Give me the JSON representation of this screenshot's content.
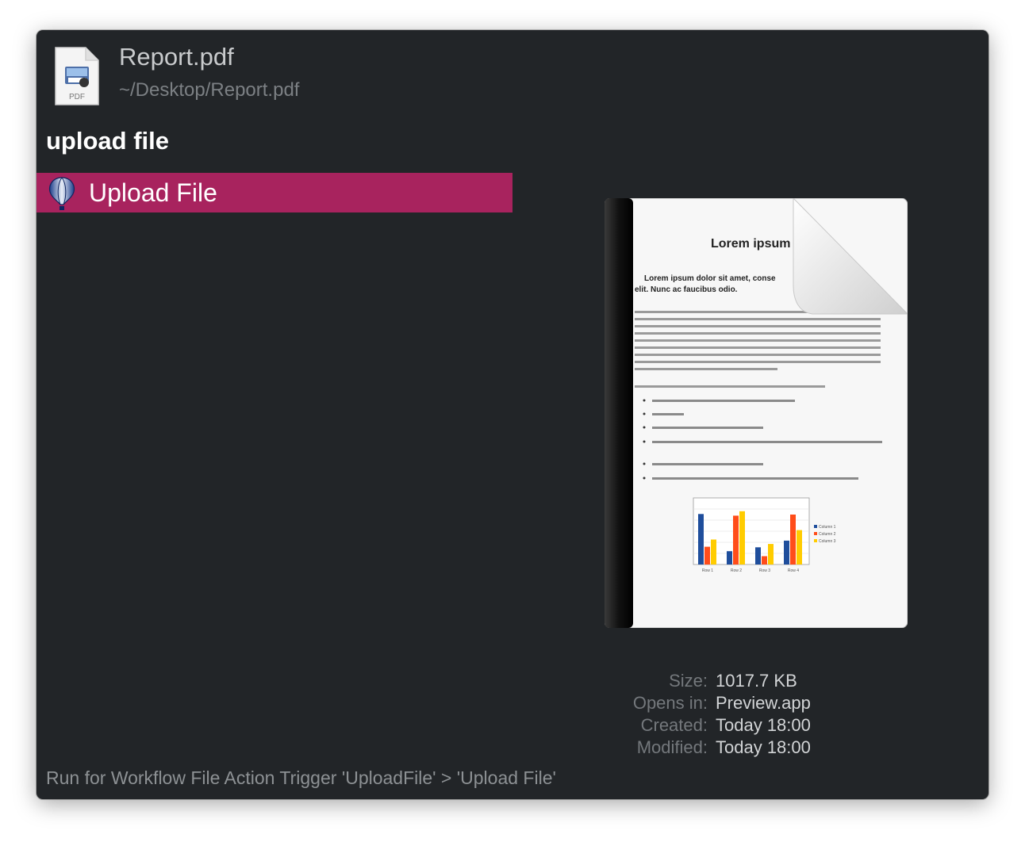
{
  "file": {
    "name": "Report.pdf",
    "path": "~/Desktop/Report.pdf",
    "icon": "pdf-file-icon",
    "icon_label": "PDF"
  },
  "query": "upload file",
  "results": [
    {
      "label": "Upload File",
      "icon": "balloon-icon",
      "selected": true
    }
  ],
  "preview": {
    "doc_title": "Lorem ipsum",
    "doc_subtitle_line1": "Lorem ipsum dolor sit amet, conse",
    "doc_subtitle_line2": "elit. Nunc ac faucibus odio.",
    "chart_categories": [
      "Row 1",
      "Row 2",
      "Row 3",
      "Row 4"
    ],
    "chart_legend": [
      "Column 1",
      "Column 2",
      "Column 3"
    ]
  },
  "metadata": {
    "size_label": "Size:",
    "size_value": "1017.7 KB",
    "opens_label": "Opens in:",
    "opens_value": "Preview.app",
    "created_label": "Created:",
    "created_value": "Today 18:00",
    "modified_label": "Modified:",
    "modified_value": "Today 18:00"
  },
  "footer": "Run for Workflow File Action Trigger 'UploadFile' > 'Upload File'",
  "colors": {
    "window_bg": "#222528",
    "selection": "#a8235e",
    "text_primary": "#ffffff",
    "text_secondary": "#7c8084"
  }
}
